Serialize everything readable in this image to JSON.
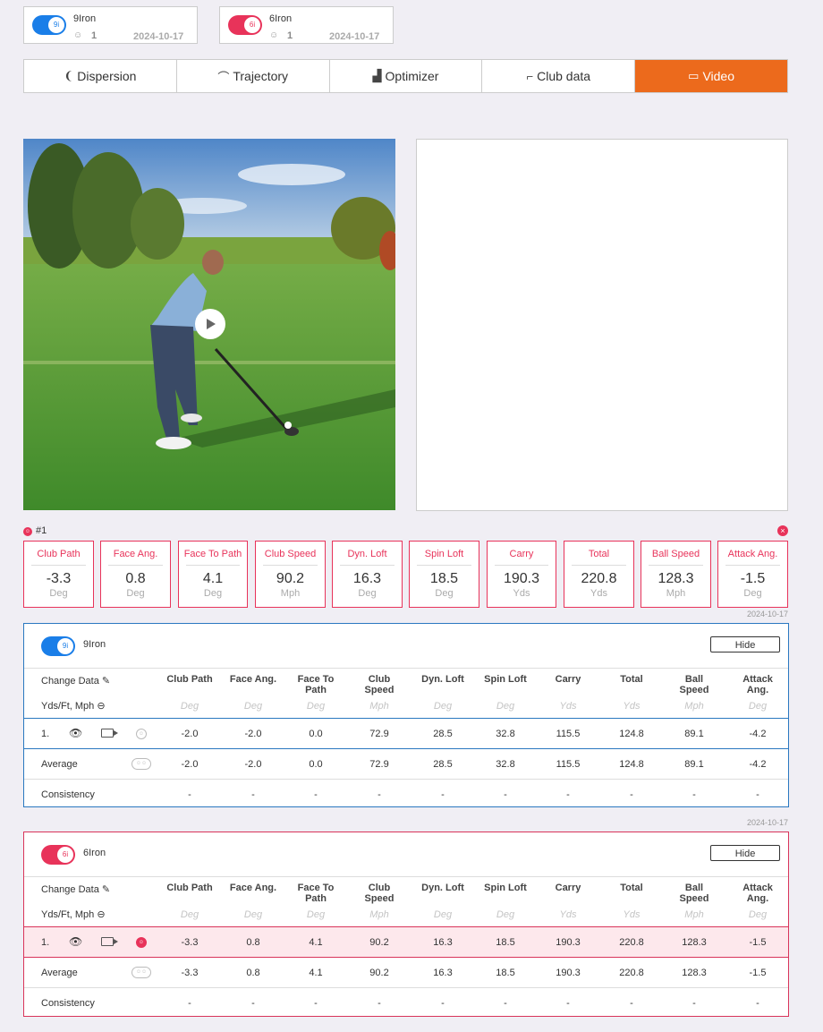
{
  "clubs": [
    {
      "badge": "9i",
      "name": "9Iron",
      "count": "1",
      "date": "2024-10-17"
    },
    {
      "badge": "6i",
      "name": "6Iron",
      "count": "1",
      "date": "2024-10-17"
    }
  ],
  "tabs": [
    {
      "label": "Dispersion",
      "icon": "footprint-icon",
      "active": false
    },
    {
      "label": "Trajectory",
      "icon": "trajectory-icon",
      "active": false
    },
    {
      "label": "Optimizer",
      "icon": "bar-chart-icon",
      "active": false
    },
    {
      "label": "Club data",
      "icon": "club-icon",
      "active": false
    },
    {
      "label": "Video",
      "icon": "video-camera-icon",
      "active": true
    }
  ],
  "shot": {
    "label": "#1",
    "metrics": [
      {
        "label": "Club Path",
        "value": "-3.3",
        "unit": "Deg"
      },
      {
        "label": "Face Ang.",
        "value": "0.8",
        "unit": "Deg"
      },
      {
        "label": "Face To Path",
        "value": "4.1",
        "unit": "Deg"
      },
      {
        "label": "Club Speed",
        "value": "90.2",
        "unit": "Mph"
      },
      {
        "label": "Dyn. Loft",
        "value": "16.3",
        "unit": "Deg"
      },
      {
        "label": "Spin Loft",
        "value": "18.5",
        "unit": "Deg"
      },
      {
        "label": "Carry",
        "value": "190.3",
        "unit": "Yds"
      },
      {
        "label": "Total",
        "value": "220.8",
        "unit": "Yds"
      },
      {
        "label": "Ball Speed",
        "value": "128.3",
        "unit": "Mph"
      },
      {
        "label": "Attack Ang.",
        "value": "-1.5",
        "unit": "Deg"
      }
    ]
  },
  "table_common": {
    "change_data": "Change Data",
    "units": "Yds/Ft, Mph",
    "hide": "Hide",
    "columns": [
      {
        "line1": "Club Path",
        "line2": "",
        "unit": "Deg"
      },
      {
        "line1": "Face Ang.",
        "line2": "",
        "unit": "Deg"
      },
      {
        "line1": "Face To",
        "line2": "Path",
        "unit": "Deg"
      },
      {
        "line1": "Club",
        "line2": "Speed",
        "unit": "Mph"
      },
      {
        "line1": "Dyn. Loft",
        "line2": "",
        "unit": "Deg"
      },
      {
        "line1": "Spin Loft",
        "line2": "",
        "unit": "Deg"
      },
      {
        "line1": "Carry",
        "line2": "",
        "unit": "Yds"
      },
      {
        "line1": "Total",
        "line2": "",
        "unit": "Yds"
      },
      {
        "line1": "Ball",
        "line2": "Speed",
        "unit": "Mph"
      },
      {
        "line1": "Attack",
        "line2": "Ang.",
        "unit": "Deg"
      }
    ],
    "row_labels": {
      "shot": "1.",
      "average": "Average",
      "consistency": "Consistency"
    }
  },
  "tables": [
    {
      "date": "2024-10-17",
      "badge": "9i",
      "name": "9Iron",
      "shot": [
        "-2.0",
        "-2.0",
        "0.0",
        "72.9",
        "28.5",
        "32.8",
        "115.5",
        "124.8",
        "89.1",
        "-4.2"
      ],
      "average": [
        "-2.0",
        "-2.0",
        "0.0",
        "72.9",
        "28.5",
        "32.8",
        "115.5",
        "124.8",
        "89.1",
        "-4.2"
      ],
      "consistency": [
        "-",
        "-",
        "-",
        "-",
        "-",
        "-",
        "-",
        "-",
        "-",
        "-"
      ]
    },
    {
      "date": "2024-10-17",
      "badge": "6i",
      "name": "6Iron",
      "shot": [
        "-3.3",
        "0.8",
        "4.1",
        "90.2",
        "16.3",
        "18.5",
        "190.3",
        "220.8",
        "128.3",
        "-1.5"
      ],
      "average": [
        "-3.3",
        "0.8",
        "4.1",
        "90.2",
        "16.3",
        "18.5",
        "190.3",
        "220.8",
        "128.3",
        "-1.5"
      ],
      "consistency": [
        "-",
        "-",
        "-",
        "-",
        "-",
        "-",
        "-",
        "-",
        "-",
        "-"
      ]
    }
  ],
  "colors": {
    "accent": "#ec6a1c",
    "blue": "#1a7ee8",
    "red": "#e8335a"
  }
}
